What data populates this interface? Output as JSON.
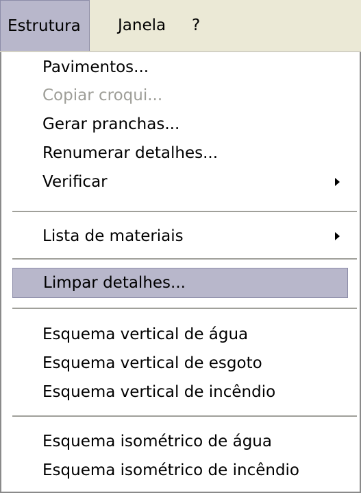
{
  "menubar": {
    "items": [
      {
        "label": "Estrutura",
        "active": true
      },
      {
        "label": "Janela",
        "active": false
      },
      {
        "label": "?",
        "active": false
      }
    ]
  },
  "menu": {
    "items": [
      {
        "label": "Pavimentos...",
        "enabled": true
      },
      {
        "label": "Copiar croqui...",
        "enabled": false
      },
      {
        "label": "Gerar pranchas...",
        "enabled": true
      },
      {
        "label": "Renumerar detalhes...",
        "enabled": true
      },
      {
        "label": "Verificar",
        "enabled": true,
        "submenu": true
      },
      {
        "label": "Lista de materiais",
        "enabled": true,
        "submenu": true
      },
      {
        "label": "Limpar detalhes...",
        "enabled": true,
        "highlighted": true
      },
      {
        "label": "Esquema vertical de água",
        "enabled": true
      },
      {
        "label": "Esquema vertical de esgoto",
        "enabled": true
      },
      {
        "label": "Esquema vertical de incêndio",
        "enabled": true
      },
      {
        "label": "Esquema isométrico de água",
        "enabled": true
      },
      {
        "label": "Esquema isométrico de incêndio",
        "enabled": true
      }
    ]
  }
}
